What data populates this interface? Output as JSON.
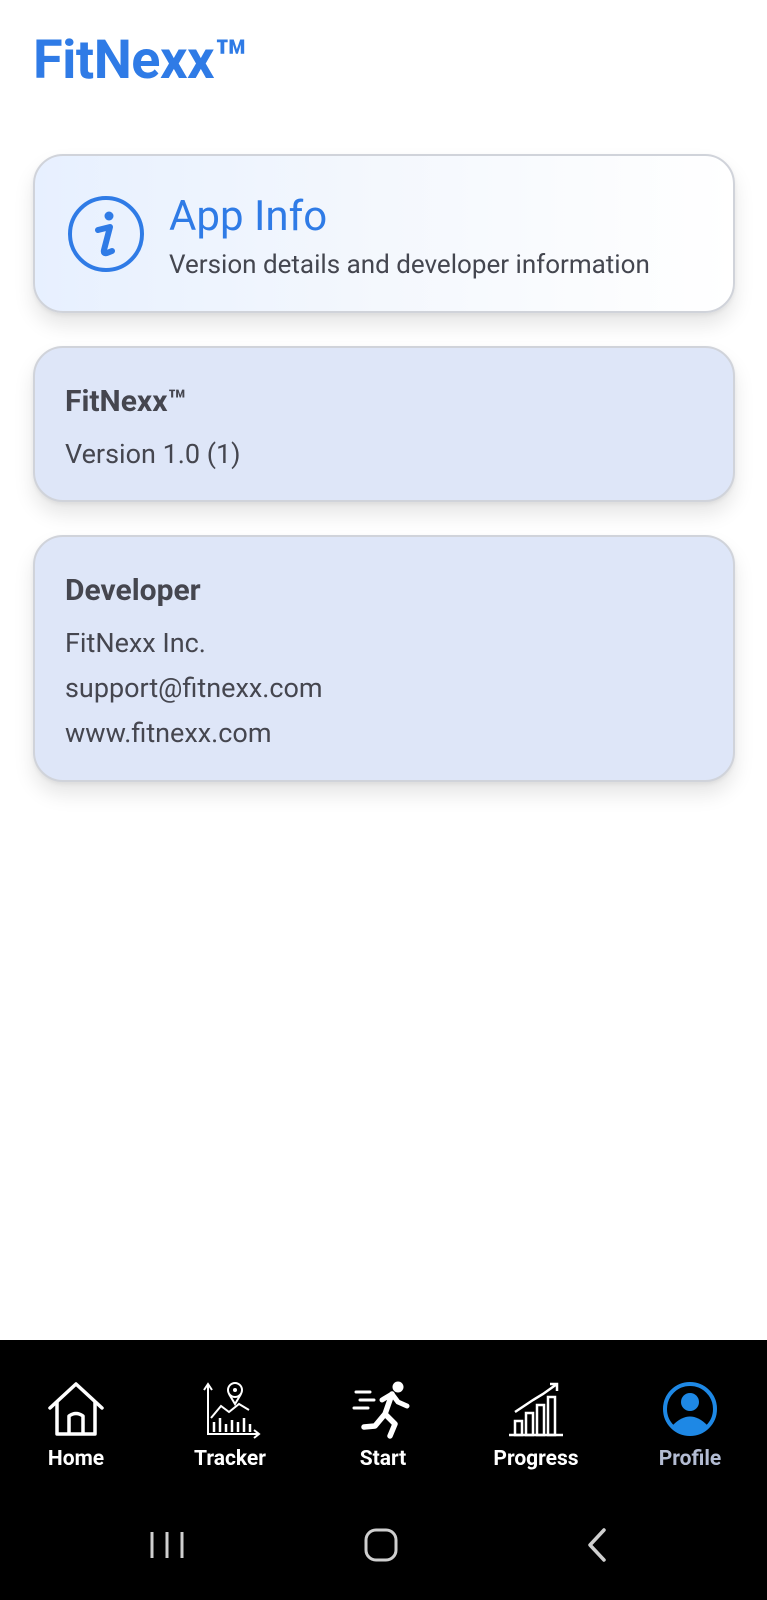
{
  "app": {
    "title": "FitNexx™"
  },
  "header": {
    "title": "App Info",
    "subtitle": "Version details and developer information",
    "icon": "info-icon"
  },
  "app_card": {
    "name": "FitNexx™",
    "version": "Version 1.0 (1)"
  },
  "developer_card": {
    "title": "Developer",
    "company": "FitNexx Inc.",
    "email": "support@fitnexx.com",
    "website": "www.fitnexx.com"
  },
  "bottom_nav": {
    "items": [
      {
        "label": "Home",
        "icon": "home-icon"
      },
      {
        "label": "Tracker",
        "icon": "tracker-icon"
      },
      {
        "label": "Start",
        "icon": "running-icon"
      },
      {
        "label": "Progress",
        "icon": "bar-chart-icon"
      },
      {
        "label": "Profile",
        "icon": "profile-icon"
      }
    ],
    "active": "Profile"
  },
  "system_nav": {
    "buttons": [
      "recent-apps-icon",
      "home-button-icon",
      "back-icon"
    ]
  },
  "colors": {
    "accent": "#2f7be6",
    "card_background": "#dee6f8",
    "text": "#45464f",
    "nav_background": "#000000",
    "nav_active": "#1e88e5",
    "nav_active_label": "#b3bcd3"
  }
}
